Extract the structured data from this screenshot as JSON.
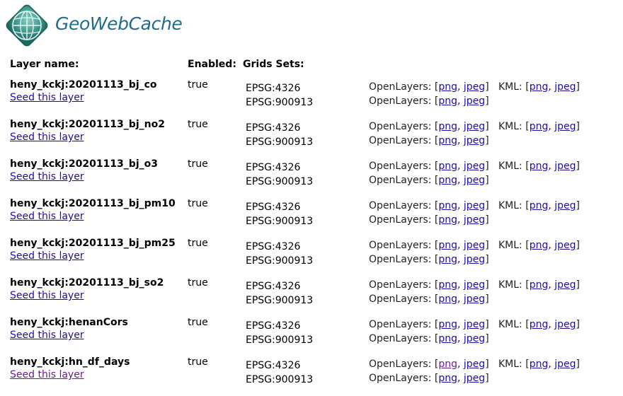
{
  "brand": {
    "name": "GeoWebCache",
    "logo_icon": "globe-logo-icon"
  },
  "headers": {
    "layer_name": "Layer name:",
    "enabled": "Enabled:",
    "grid_sets": "Grids Sets:"
  },
  "labels": {
    "seed": "Seed this layer",
    "openlayers": "OpenLayers: ",
    "kml": "KML: ",
    "png": "png",
    "jpeg": "jpeg",
    "open_bracket": "[",
    "close_bracket": "]",
    "comma": ", "
  },
  "layers": [
    {
      "name": "heny_kckj:20201113_bj_co",
      "enabled": "true",
      "grids": [
        "EPSG:4326",
        "EPSG:900913"
      ]
    },
    {
      "name": "heny_kckj:20201113_bj_no2",
      "enabled": "true",
      "grids": [
        "EPSG:4326",
        "EPSG:900913"
      ]
    },
    {
      "name": "heny_kckj:20201113_bj_o3",
      "enabled": "true",
      "grids": [
        "EPSG:4326",
        "EPSG:900913"
      ]
    },
    {
      "name": "heny_kckj:20201113_bj_pm10",
      "enabled": "true",
      "grids": [
        "EPSG:4326",
        "EPSG:900913"
      ]
    },
    {
      "name": "heny_kckj:20201113_bj_pm25",
      "enabled": "true",
      "grids": [
        "EPSG:4326",
        "EPSG:900913"
      ]
    },
    {
      "name": "heny_kckj:20201113_bj_so2",
      "enabled": "true",
      "grids": [
        "EPSG:4326",
        "EPSG:900913"
      ]
    },
    {
      "name": "heny_kckj:henanCors",
      "enabled": "true",
      "grids": [
        "EPSG:4326",
        "EPSG:900913"
      ]
    },
    {
      "name": "heny_kckj:hn_df_days",
      "enabled": "true",
      "grids": [
        "EPSG:4326",
        "EPSG:900913"
      ]
    }
  ],
  "colors": {
    "link": "#1a0dab",
    "visited_link": "#6a1b9a",
    "brand": "#1d6d8a"
  }
}
